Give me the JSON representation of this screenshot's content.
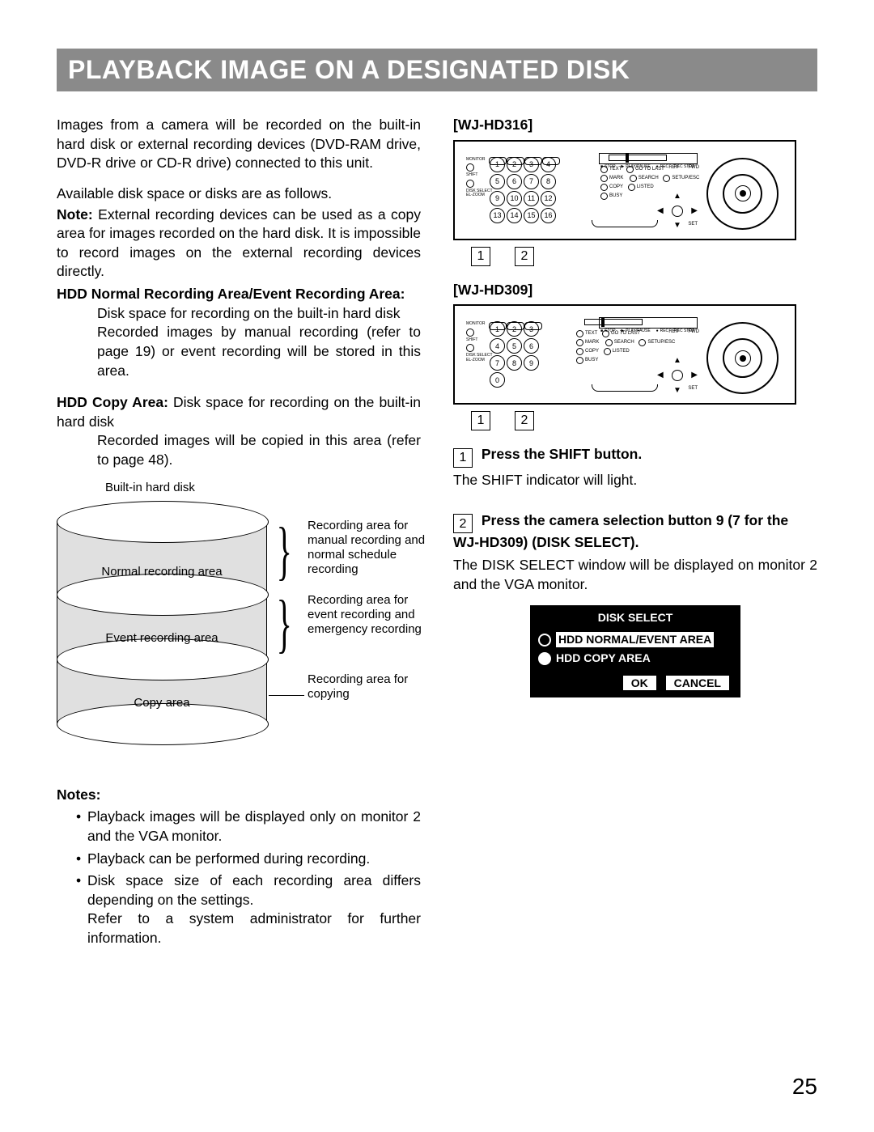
{
  "title": "PLAYBACK IMAGE ON A DESIGNATED DISK",
  "page_number": "25",
  "left": {
    "intro1": "Images from a camera will be recorded on the built-in hard disk or external recording devices (DVD-RAM drive, DVD-R drive or CD-R drive) connected to this unit.",
    "intro2": "Available disk space or disks are as follows.",
    "note_label": "Note:",
    "note_body": "External recording devices can be used as a copy area for images recorded on the hard disk. It is impossible to record images on the external recording devices directly.",
    "hdd_normal_head": "HDD Normal Recording Area/Event Recording Area:",
    "hdd_normal_l1": "Disk space for recording on the built-in hard disk",
    "hdd_normal_l2": "Recorded images by manual recording (refer to page 19) or event recording will be stored in this area.",
    "hdd_copy_head": "HDD Copy Area:",
    "hdd_copy_l1": "Disk space for recording on the built-in hard disk",
    "hdd_copy_l2": "Recorded images will be copied in this area (refer to page 48).",
    "diagram": {
      "top_label": "Built-in hard disk",
      "slice1": "Normal recording area",
      "slice2": "Event recording area",
      "slice3": "Copy area",
      "anno1": "Recording area for manual recording and normal schedule recording",
      "anno2": "Recording area for event recording and emergency recording",
      "anno3": "Recording area for copying"
    },
    "notes_head": "Notes:",
    "notes": {
      "n1": "Playback images will be displayed only on monitor 2 and the VGA monitor.",
      "n2": "Playback can be performed during recording.",
      "n3": "Disk space size of each recording area differs depending on the settings.",
      "n3b": "Refer to a system administrator for further information."
    }
  },
  "right": {
    "model_a": "[WJ-HD316]",
    "model_b": "[WJ-HD309]",
    "callout1": "1",
    "callout2": "2",
    "step1_title": "Press the SHIFT button.",
    "step1_body": "The SHIFT indicator will light.",
    "step2_title": "Press the camera selection button 9 (7 for the WJ-HD309) (DISK SELECT).",
    "step2_body": "The DISK SELECT window will be displayed on monitor 2 and the VGA monitor.",
    "osd": {
      "title": "DISK SELECT",
      "opt1": "HDD NORMAL/EVENT AREA",
      "opt2": "HDD COPY AREA",
      "ok": "OK",
      "cancel": "CANCEL"
    },
    "panel_words": {
      "monitor": "MONITOR",
      "shift": "SHIFT",
      "disk_sel": "DISK SELECT",
      "el_zoom": "EL-ZOOM",
      "stop": "STOP",
      "play_pause": "PLAY/PAUSE",
      "rec": "REC",
      "rec_stop": "REC STOP",
      "rev": "REV",
      "fwd": "FWD",
      "set": "SET",
      "busy": "BUSY",
      "search": "SEARCH",
      "setup": "SETUP/ESC",
      "text": "TEXT",
      "mark": "MARK",
      "goto_last": "GO TO LAST",
      "copy": "COPY",
      "listed": "LISTED"
    }
  }
}
